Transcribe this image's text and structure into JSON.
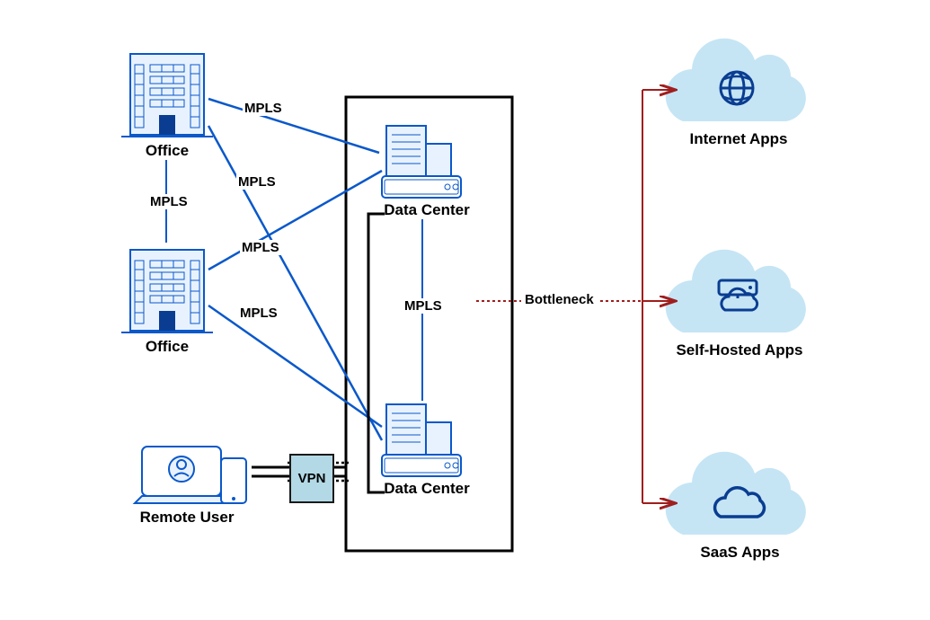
{
  "nodes": {
    "office1": {
      "label": "Office"
    },
    "office2": {
      "label": "Office"
    },
    "remoteUser": {
      "label": "Remote User"
    },
    "datacenter1": {
      "label": "Data Center"
    },
    "datacenter2": {
      "label": "Data Center"
    },
    "internetApps": {
      "label": "Internet Apps"
    },
    "selfHostedApps": {
      "label": "Self-Hosted Apps"
    },
    "saasApps": {
      "label": "SaaS Apps"
    }
  },
  "links": {
    "mpls1": "MPLS",
    "mpls2": "MPLS",
    "mpls3": "MPLS",
    "mpls4": "MPLS",
    "mpls5": "MPLS",
    "mpls6": "MPLS"
  },
  "vpnLabel": "VPN",
  "bottleneckLabel": "Bottleneck"
}
